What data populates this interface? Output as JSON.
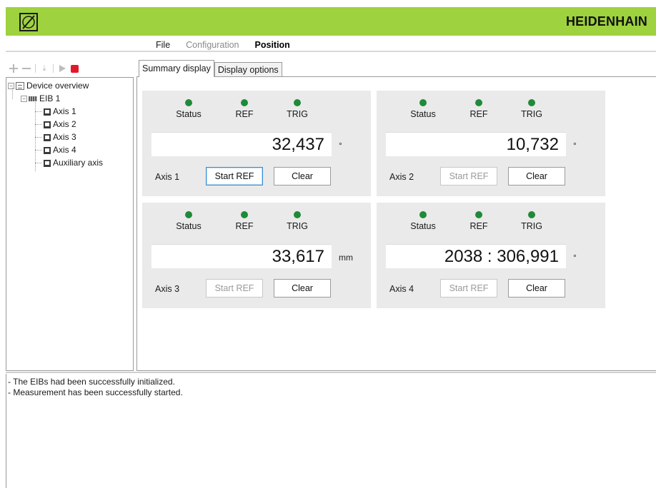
{
  "header": {
    "brand": "HEIDENHAIN",
    "logo_icon": "axis-logo-icon",
    "color": "#9ed23e"
  },
  "menu": {
    "items": [
      {
        "label": "File",
        "state": "enabled"
      },
      {
        "label": "Configuration",
        "state": "disabled"
      },
      {
        "label": "Position",
        "state": "active"
      }
    ]
  },
  "toolbar": {
    "icons": [
      "plus-icon",
      "minus-icon",
      "download-icon",
      "play-icon",
      "stop-icon"
    ]
  },
  "tree": {
    "root": "Device overview",
    "device": "EIB 1",
    "axes": [
      "Axis 1",
      "Axis 2",
      "Axis 3",
      "Axis 4",
      "Auxiliary axis"
    ]
  },
  "tabs": [
    {
      "label": "Summary display",
      "selected": true
    },
    {
      "label": "Display options",
      "selected": false
    }
  ],
  "indicators": {
    "status": "Status",
    "ref": "REF",
    "trig": "TRIG",
    "led_color": "#1f8a3a"
  },
  "axes": [
    {
      "name": "Axis 1",
      "value": "32,437",
      "unit": "°",
      "start_ref": "Start REF",
      "start_ref_enabled": true,
      "clear": "Clear"
    },
    {
      "name": "Axis 2",
      "value": "10,732",
      "unit": "°",
      "start_ref": "Start REF",
      "start_ref_enabled": false,
      "clear": "Clear"
    },
    {
      "name": "Axis 3",
      "value": "33,617",
      "unit": "mm",
      "start_ref": "Start REF",
      "start_ref_enabled": false,
      "clear": "Clear"
    },
    {
      "name": "Axis 4",
      "value": "2038 : 306,991",
      "unit": "°",
      "start_ref": "Start REF",
      "start_ref_enabled": false,
      "clear": "Clear"
    }
  ],
  "log": [
    "- The EIBs had been successfully initialized.",
    "- Measurement has been successfully started."
  ]
}
